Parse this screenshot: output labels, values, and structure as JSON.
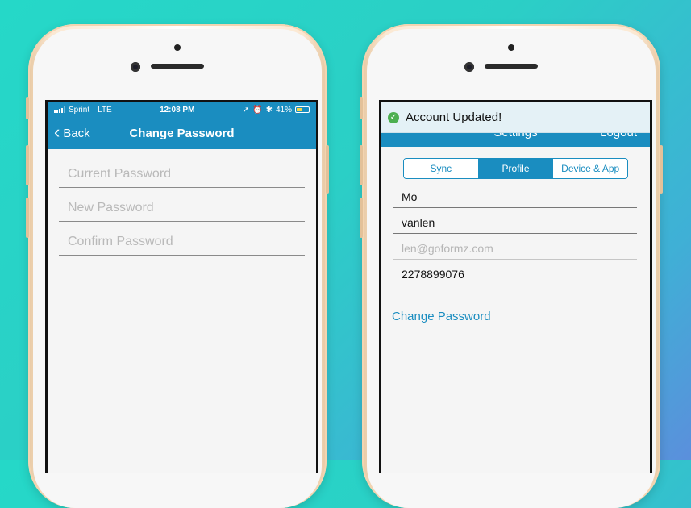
{
  "left_phone": {
    "statusbar": {
      "carrier": "Sprint",
      "network": "LTE",
      "time": "12:08 PM",
      "battery": "41%",
      "battery_level": 0.41
    },
    "navbar": {
      "back_label": "Back",
      "title": "Change Password"
    },
    "fields": [
      {
        "placeholder": "Current Password",
        "value": ""
      },
      {
        "placeholder": "New Password",
        "value": ""
      },
      {
        "placeholder": "Confirm Password",
        "value": ""
      }
    ]
  },
  "right_phone": {
    "toast": {
      "message": "Account Updated!",
      "icon": "check-circle-icon",
      "color": "#4caf50"
    },
    "header": {
      "title": "Settings",
      "logout_label": "Logout"
    },
    "tabs": [
      {
        "label": "Sync",
        "active": false
      },
      {
        "label": "Profile",
        "active": true
      },
      {
        "label": "Device & App",
        "active": false
      }
    ],
    "profile": {
      "first_name": "Mo",
      "last_name": "vanlen",
      "email": "len@goformz.com",
      "phone": "2278899076"
    },
    "change_password_label": "Change Password"
  },
  "colors": {
    "accent": "#1a8dc0",
    "background_start": "#25d8c8",
    "background_end": "#5b8fdc"
  }
}
